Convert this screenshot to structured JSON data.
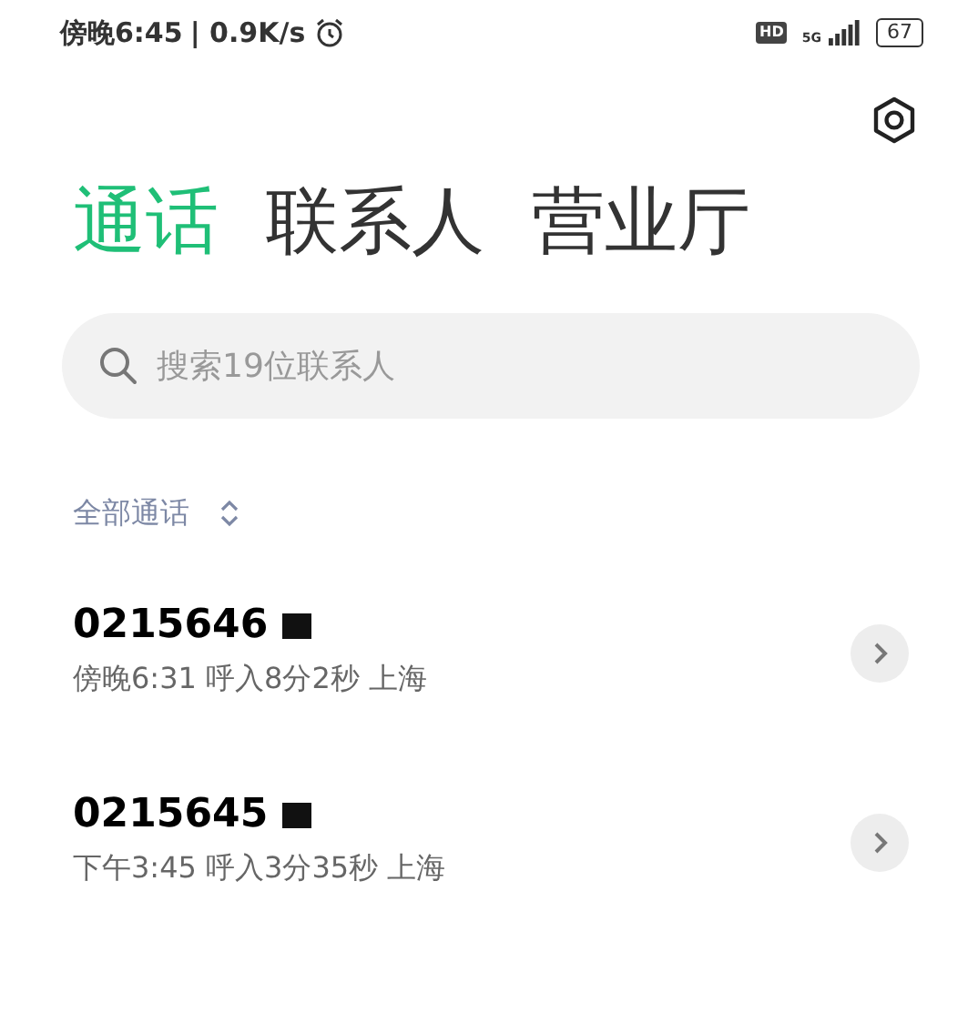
{
  "status_bar": {
    "time": "傍晚6:45",
    "speed": "| 0.9K/s",
    "hd": "HD",
    "network": "5G",
    "battery": "67"
  },
  "tabs": [
    {
      "label": "通话",
      "selected": true
    },
    {
      "label": "联系人",
      "selected": false
    },
    {
      "label": "营业厅",
      "selected": false
    }
  ],
  "search": {
    "placeholder": "搜索19位联系人"
  },
  "filter": {
    "label": "全部通话"
  },
  "calls": [
    {
      "number": "0215646",
      "detail": "傍晚6:31 呼入8分2秒 上海"
    },
    {
      "number": "0215645",
      "detail": "下午3:45 呼入3分35秒 上海"
    }
  ]
}
